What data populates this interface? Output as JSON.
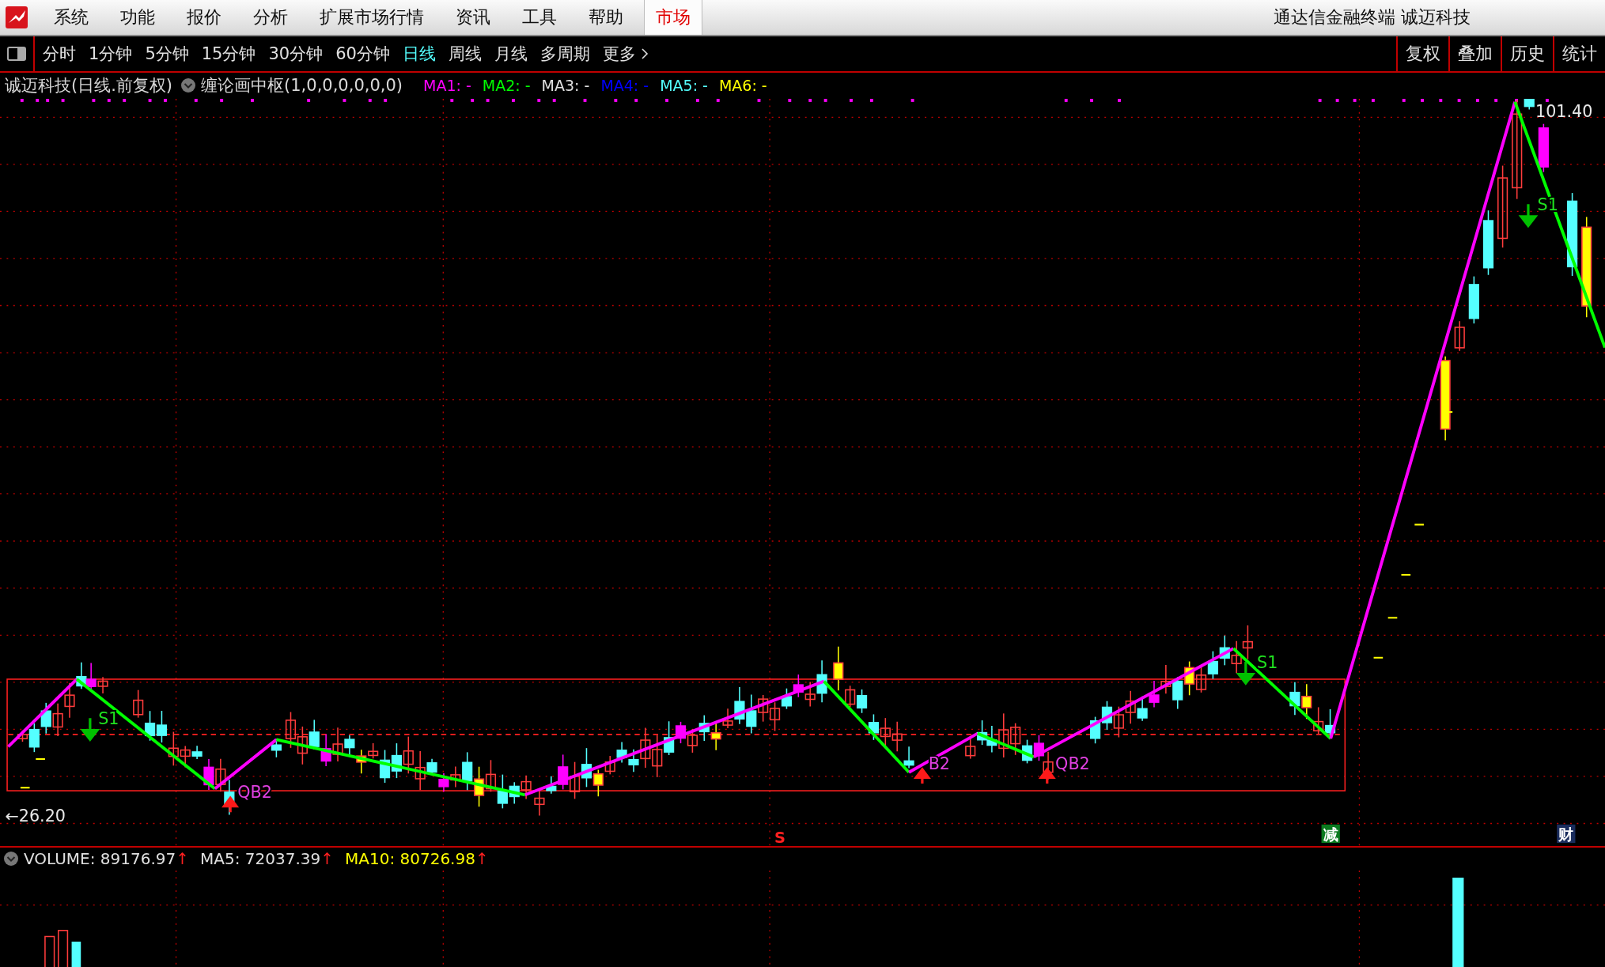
{
  "window": {
    "title": "通达信金融终端 诚迈科技"
  },
  "menu": [
    {
      "label": "系统"
    },
    {
      "label": "功能"
    },
    {
      "label": "报价"
    },
    {
      "label": "分析"
    },
    {
      "label": "扩展市场行情"
    },
    {
      "label": "资讯"
    },
    {
      "label": "工具"
    },
    {
      "label": "帮助"
    }
  ],
  "market_tab": {
    "label": "市场",
    "selected": true
  },
  "periods": [
    {
      "label": "分时",
      "selected": false
    },
    {
      "label": "1分钟",
      "selected": false
    },
    {
      "label": "5分钟",
      "selected": false
    },
    {
      "label": "15分钟",
      "selected": false
    },
    {
      "label": "30分钟",
      "selected": false
    },
    {
      "label": "60分钟",
      "selected": false
    },
    {
      "label": "日线",
      "selected": true
    },
    {
      "label": "周线",
      "selected": false
    },
    {
      "label": "月线",
      "selected": false
    },
    {
      "label": "多周期",
      "selected": false
    },
    {
      "label": "更多",
      "selected": false
    }
  ],
  "tools": [
    "复权",
    "叠加",
    "历史",
    "统计"
  ],
  "legend": {
    "security": "诚迈科技(日线.前复权)",
    "indicator": "缠论画中枢(1,0,0,0,0,0,0)",
    "ma": [
      {
        "label": "MA1: -",
        "color": "#ff00ff"
      },
      {
        "label": "MA2: -",
        "color": "#00ff00"
      },
      {
        "label": "MA3: -",
        "color": "#e0e0e0"
      },
      {
        "label": "MA4: -",
        "color": "#0000ff"
      },
      {
        "label": "MA5: -",
        "color": "#54ffff"
      },
      {
        "label": "MA6: -",
        "color": "#ffff00"
      }
    ]
  },
  "chart": {
    "high_label": "101.40",
    "low_label": "←26.20",
    "signals": [
      {
        "kind": "sell",
        "text": "S1"
      },
      {
        "kind": "buy",
        "text": "QB2"
      },
      {
        "kind": "buy",
        "text": "B2"
      },
      {
        "kind": "buy",
        "text": "QB2"
      },
      {
        "kind": "sell",
        "text": "S1"
      },
      {
        "kind": "sell",
        "text": "S1"
      }
    ],
    "badges": [
      {
        "kind": "mark",
        "text": "S"
      },
      {
        "kind": "green",
        "text": "减"
      },
      {
        "kind": "navy",
        "text": "财"
      }
    ]
  },
  "volume": {
    "items": [
      {
        "label": "VOLUME: 89176.97",
        "color": "#e0e0e0",
        "arrow": "↑"
      },
      {
        "label": "MA5: 72037.39",
        "color": "#e0e0e0",
        "arrow": "↑"
      },
      {
        "label": "MA10: 80726.98",
        "color": "#ffff00",
        "arrow": "↑"
      }
    ]
  }
}
